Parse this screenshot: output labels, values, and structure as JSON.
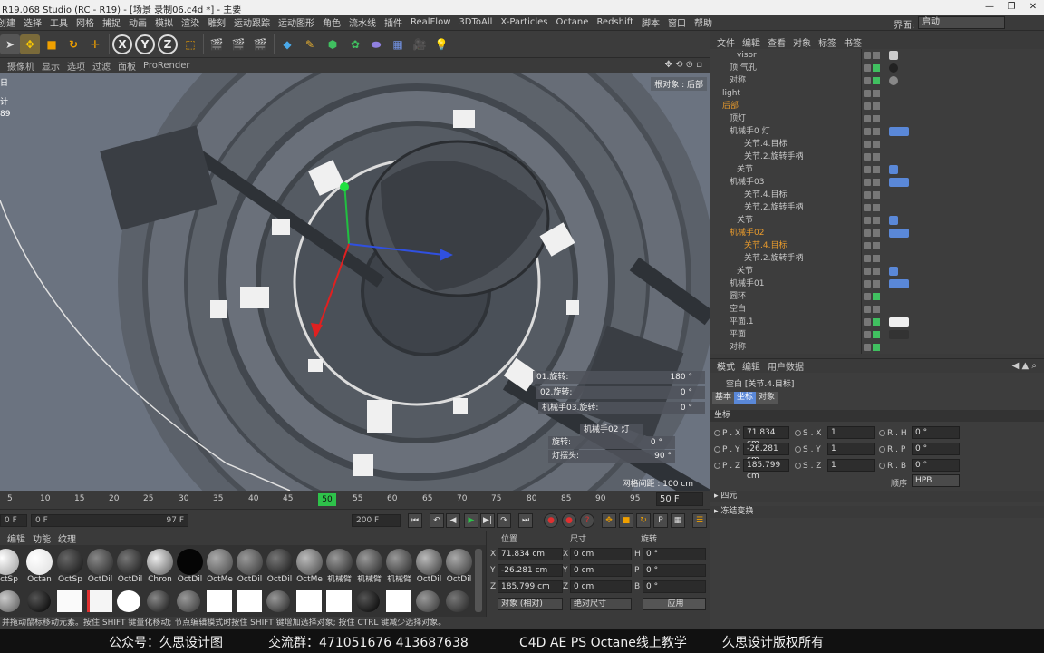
{
  "app": {
    "title": "R19.068 Studio (RC - R19) - [场景 录制06.c4d *] - 主要",
    "win_buttons": [
      "—",
      "❐",
      "✕"
    ]
  },
  "menu": [
    "创建",
    "选择",
    "工具",
    "网格",
    "捕捉",
    "动画",
    "模拟",
    "渲染",
    "雕刻",
    "运动跟踪",
    "运动图形",
    "角色",
    "流水线",
    "插件",
    "RealFlow",
    "3DToAll",
    "X-Particles",
    "Octane",
    "Redshift",
    "脚本",
    "窗口",
    "帮助"
  ],
  "layout": {
    "label": "界面:",
    "value": "启动"
  },
  "viewport_menu": [
    "摄像机",
    "显示",
    "选项",
    "过滤",
    "面板",
    "ProRender"
  ],
  "viewport": {
    "camera_label": "根对象 : 后部",
    "grid_label": "网格间距 : 100 cm",
    "left_labels": [
      "日",
      "计",
      "89"
    ],
    "hud": [
      {
        "label": "01.旋转:",
        "value": "180 °"
      },
      {
        "label": "02.旋转:",
        "value": "0 °"
      },
      {
        "label": "机械手03.旋转:",
        "value": "0 °"
      },
      {
        "label": "机械手02 灯",
        "value": ""
      },
      {
        "label": "旋转:",
        "value": "0 °"
      },
      {
        "label": "灯摆头:",
        "value": "90 °"
      }
    ]
  },
  "timeline": {
    "ticks": [
      "5",
      "10",
      "15",
      "20",
      "25",
      "30",
      "35",
      "40",
      "45",
      "50",
      "55",
      "60",
      "65",
      "70",
      "75",
      "80",
      "85",
      "90",
      "95"
    ],
    "current": "50",
    "current_frame": "50 F",
    "start": "0 F",
    "range_start": "0 F",
    "range_end": "97 F",
    "end": "200 F"
  },
  "material_menu": [
    "编辑",
    "功能",
    "纹理"
  ],
  "materials_row1": [
    "OctSp",
    "Octan",
    "OctSp",
    "OctDil",
    "OctDil",
    "Chron",
    "OctDil",
    "OctMe",
    "OctDil",
    "OctDil",
    "OctMe",
    "机械臂",
    "机械臂",
    "机械臂",
    "OctDil",
    "OctDil"
  ],
  "coords": {
    "headers": [
      "位置",
      "尺寸",
      "旋转"
    ],
    "rows": [
      {
        "a": "X",
        "pos": "71.834 cm",
        "b": "X",
        "size": "0 cm",
        "c": "H",
        "rot": "0 °"
      },
      {
        "a": "Y",
        "pos": "-26.281 cm",
        "b": "Y",
        "size": "0 cm",
        "c": "P",
        "rot": "0 °"
      },
      {
        "a": "Z",
        "pos": "185.799 cm",
        "b": "Z",
        "size": "0 cm",
        "c": "B",
        "rot": "0 °"
      }
    ],
    "mode": "对象 (相对)",
    "size_mode": "绝对尺寸",
    "apply": "应用"
  },
  "status": "并拖动鼠标移动元素。按住 SHIFT 键量化移动; 节点编辑模式时按住 SHIFT 键增加选择对象; 按住 CTRL 键减少选择对象。",
  "watermark": [
    "公众号：久思设计图",
    "交流群：471051676   413687638",
    "C4D AE PS Octane线上教学",
    "久思设计版权所有"
  ],
  "object_menu": [
    "文件",
    "编辑",
    "查看",
    "对象",
    "标签",
    "书签"
  ],
  "objects": [
    {
      "name": "visor",
      "indent": 2,
      "color": "#c8c8c8"
    },
    {
      "name": "顶 气孔",
      "indent": 1,
      "color": "#c8c8c8"
    },
    {
      "name": "对称",
      "indent": 1,
      "color": "#c8c8c8"
    },
    {
      "name": "light",
      "indent": 0,
      "color": "#c8c8c8"
    },
    {
      "name": "后部",
      "indent": 0,
      "color": "#e89a2c"
    },
    {
      "name": "顶灯",
      "indent": 1,
      "color": "#c8c8c8"
    },
    {
      "name": "机械手0 灯",
      "indent": 1,
      "color": "#c8c8c8"
    },
    {
      "name": "关节.4.目标",
      "indent": 2,
      "color": "#c8c8c8"
    },
    {
      "name": "关节.2.旋转手柄",
      "indent": 2,
      "color": "#c8c8c8"
    },
    {
      "name": "关节",
      "indent": 2,
      "color": "#c8c8c8"
    },
    {
      "name": "机械手03",
      "indent": 1,
      "color": "#c8c8c8"
    },
    {
      "name": "关节.4.目标",
      "indent": 2,
      "color": "#c8c8c8"
    },
    {
      "name": "关节.2.旋转手柄",
      "indent": 2,
      "color": "#c8c8c8"
    },
    {
      "name": "关节",
      "indent": 2,
      "color": "#c8c8c8"
    },
    {
      "name": "机械手02",
      "indent": 1,
      "color": "#e89a2c"
    },
    {
      "name": "关节.4.目标",
      "indent": 2,
      "color": "#e89a2c"
    },
    {
      "name": "关节.2.旋转手柄",
      "indent": 2,
      "color": "#c8c8c8"
    },
    {
      "name": "关节",
      "indent": 2,
      "color": "#c8c8c8"
    },
    {
      "name": "机械手01",
      "indent": 1,
      "color": "#c8c8c8"
    },
    {
      "name": "圆环",
      "indent": 1,
      "color": "#c8c8c8"
    },
    {
      "name": "空白",
      "indent": 1,
      "color": "#c8c8c8"
    },
    {
      "name": "平面.1",
      "indent": 1,
      "color": "#c8c8c8"
    },
    {
      "name": "平面",
      "indent": 1,
      "color": "#c8c8c8"
    },
    {
      "name": "对称",
      "indent": 1,
      "color": "#c8c8c8"
    }
  ],
  "attr_menu": [
    "模式",
    "编辑",
    "用户数据"
  ],
  "attr": {
    "title": "空白 [关节.4.目标]",
    "tabs": [
      "基本",
      "坐标",
      "对象"
    ],
    "section": "坐标",
    "rows": [
      {
        "p": "P . X",
        "pv": "71.834 cm",
        "s": "S . X",
        "sv": "1",
        "r": "R . H",
        "rv": "0 °"
      },
      {
        "p": "P . Y",
        "pv": "-26.281 cm",
        "s": "S . Y",
        "sv": "1",
        "r": "R . P",
        "rv": "0 °"
      },
      {
        "p": "P . Z",
        "pv": "185.799 cm",
        "s": "S . Z",
        "sv": "1",
        "r": "R . B",
        "rv": "0 °"
      }
    ],
    "order_label": "顺序",
    "order": "HPB",
    "collapsed": [
      "四元",
      "冻结变换"
    ]
  }
}
